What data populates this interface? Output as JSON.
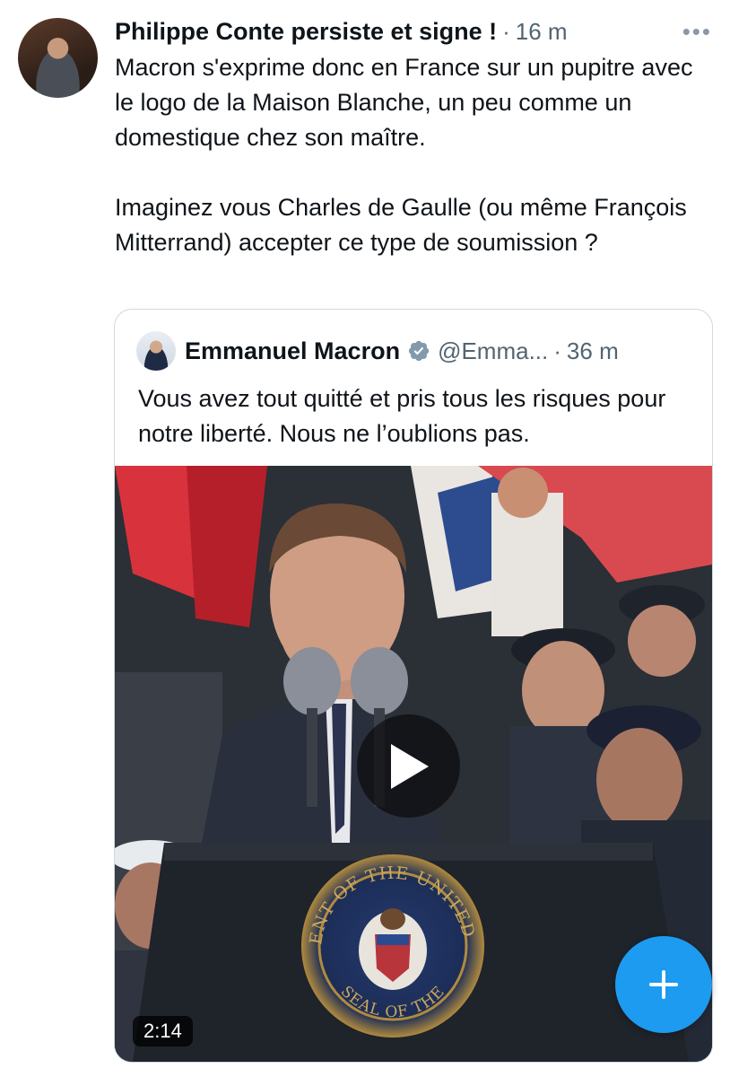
{
  "post": {
    "author": "Philippe Conte persiste et signe !",
    "separator": "·",
    "time": "16 m",
    "more": "•••",
    "paragraph1": "Macron s'exprime donc en France sur un pupitre avec le logo de la Maison Blanche, un peu comme un domestique chez son maître.",
    "paragraph2": "Imaginez vous Charles de Gaulle (ou même François Mitterrand) accepter ce type de soumission ?"
  },
  "quote": {
    "name": "Emmanuel Macron",
    "handle": "@Emma...",
    "separator": "·",
    "time": "36 m",
    "text": "Vous avez tout quitté et pris tous les risques pour notre liberté. Nous ne l’oublions pas.",
    "video_duration": "2:14",
    "seal_text": "PRESIDENT OF THE UNITED STATES",
    "seal_bottom_text": "SEAL OF THE"
  },
  "fab": {
    "label": "+"
  },
  "colors": {
    "accent": "#1d9bf0",
    "verified": "#829aab",
    "secondary_text": "#536471"
  },
  "icons": {
    "verified": "verified-badge-icon",
    "play": "play-icon",
    "compose": "plus-icon",
    "more": "more-dots-icon"
  }
}
